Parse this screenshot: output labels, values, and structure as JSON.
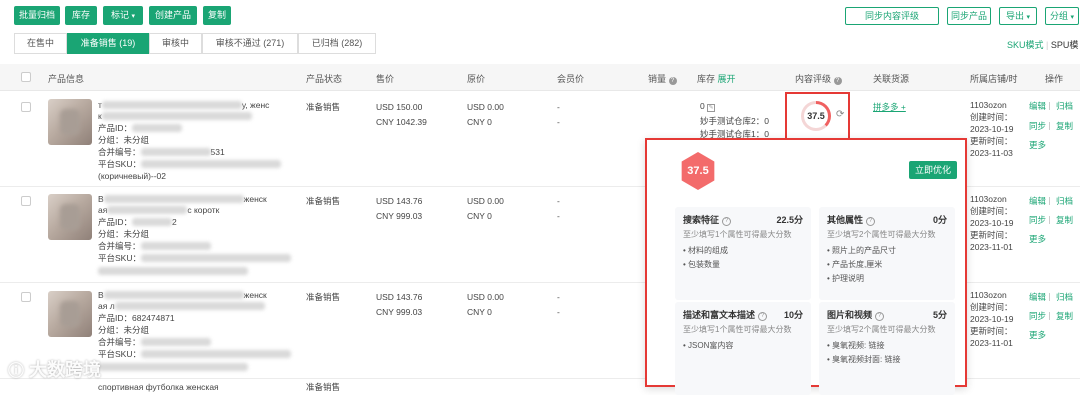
{
  "toolbar": {
    "batch_archive": "批量归档",
    "inventory": "库存",
    "tag": "标记",
    "create_product": "创建产品",
    "copy": "复制",
    "sync_content_score": "同步内容评级",
    "sync_product": "同步产品",
    "export": "导出",
    "group": "分组"
  },
  "tabs": [
    {
      "label": "在售中"
    },
    {
      "label": "准备销售 (19)"
    },
    {
      "label": "审核中"
    },
    {
      "label": "审核不通过 (271)"
    },
    {
      "label": "已归档 (282)"
    }
  ],
  "mode": {
    "sku": "SKU模式",
    "spu": "SPU模"
  },
  "columns": {
    "info": "产品信息",
    "status": "产品状态",
    "price": "售价",
    "orig_price": "原价",
    "member_price": "会员价",
    "sales": "销量",
    "stock": "库存",
    "expand": "展开",
    "content_score": "内容评级",
    "source": "关联货源",
    "store": "所属店铺/时",
    "actions": "操作"
  },
  "rows": [
    {
      "title1": "т",
      "title1b": "у, женс",
      "title2": "к",
      "id_label": "产品ID：",
      "id_val": "",
      "group": "分组：未分组",
      "merge_label": "合并编号：",
      "merge_val": "531",
      "sku_label": "平台SKU：",
      "sku_val": "(коричневый)--02",
      "status": "准备销售",
      "price_usd": "USD 150.00",
      "price_cny": "CNY 1042.39",
      "orig_usd": "USD 0.00",
      "orig_cny": "CNY 0",
      "member": "-",
      "sales": "-",
      "stock_val": "0",
      "stock_l1": "妙手测试仓库2：0",
      "stock_l2": "妙手测试仓库1：0",
      "score": "37.5",
      "source": "拼多多 +",
      "store": "1103ozon",
      "created_label": "创建时间：",
      "created": "2023-10-19",
      "updated_label": "更新时间：",
      "updated": "2023-11-03",
      "actions": [
        "编辑",
        "归档",
        "同步",
        "复制",
        "更多"
      ]
    },
    {
      "title1": "В",
      "title1b": "женск",
      "title2": "ая",
      "title2b": "с коротк",
      "id_label": "产品ID：",
      "id_val": "2",
      "group": "分组：未分组",
      "merge_label": "合并编号：",
      "merge_val": "",
      "sku_label": "平台SKU：",
      "sku_val": "",
      "status": "准备销售",
      "price_usd": "USD 143.76",
      "price_cny": "CNY 999.03",
      "orig_usd": "USD 0.00",
      "orig_cny": "CNY 0",
      "member": "-",
      "sales": "-",
      "store": "1103ozon",
      "created_label": "创建时间：",
      "created": "2023-10-19",
      "updated_label": "更新时间：",
      "updated": "2023-11-01",
      "actions": [
        "编辑",
        "归档",
        "同步",
        "复制",
        "更多"
      ]
    },
    {
      "title1": "В",
      "title1b": "женск",
      "title2": "ая л",
      "id_label": "产品ID：",
      "id_val": "682474871",
      "group": "分组：未分组",
      "merge_label": "合并编号：",
      "merge_val": "",
      "sku_label": "平台SKU：",
      "sku_val": "",
      "status": "准备销售",
      "price_usd": "USD 143.76",
      "price_cny": "CNY 999.03",
      "orig_usd": "USD 0.00",
      "orig_cny": "CNY 0",
      "member": "-",
      "sales": "-",
      "store": "1103ozon",
      "created_label": "创建时间：",
      "created": "2023-10-19",
      "updated_label": "更新时间：",
      "updated": "2023-11-01",
      "actions": [
        "编辑",
        "归档",
        "同步",
        "复制",
        "更多"
      ]
    },
    {
      "title1": "спортивная футболка женская",
      "status": "准备销售"
    }
  ],
  "popup": {
    "score": "37.5",
    "optimize_btn": "立即优化",
    "cards": [
      {
        "title": "搜索特征",
        "score": "22.5分",
        "sub": "至少填写1个属性可得最大分数",
        "items": [
          "• 材料的组成",
          "• 包装数量"
        ]
      },
      {
        "title": "其他属性",
        "score": "0分",
        "sub": "至少填写2个属性可得最大分数",
        "items": [
          "• 照片上的产品尺寸",
          "• 产品长度,厘米",
          "• 护理说明"
        ]
      },
      {
        "title": "描述和富文本描述",
        "score": "10分",
        "sub": "至少填写1个属性可得最大分数",
        "items": [
          "• JSON富内容"
        ]
      },
      {
        "title": "图片和视频",
        "score": "5分",
        "sub": "至少填写2个属性可得最大分数",
        "items": [
          "• 臭氧视频: 链接",
          "• 臭氧视频封面: 链接"
        ]
      }
    ]
  },
  "watermark": "大数跨境",
  "colors": {
    "accent": "#1aa574",
    "highlight": "#e53935",
    "score": "#f06060"
  }
}
